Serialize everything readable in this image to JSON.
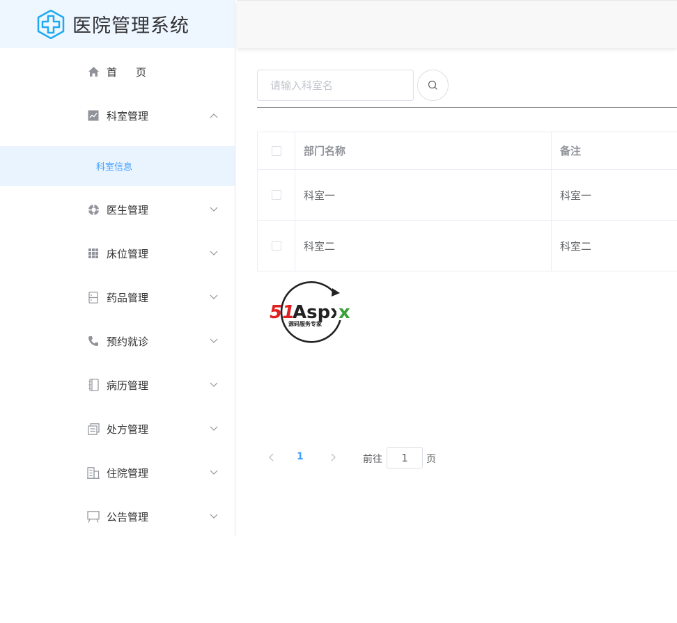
{
  "app": {
    "title": "医院管理系统"
  },
  "sidebar": {
    "items": [
      {
        "label": "首　页",
        "icon": "home-icon"
      },
      {
        "label": "科室管理",
        "icon": "chart-icon",
        "expanded": true
      },
      {
        "label": "医生管理",
        "icon": "help-circle-icon"
      },
      {
        "label": "床位管理",
        "icon": "grid-icon"
      },
      {
        "label": "药品管理",
        "icon": "cabinet-icon"
      },
      {
        "label": "预约就诊",
        "icon": "phone-icon"
      },
      {
        "label": "病历管理",
        "icon": "notebook-icon"
      },
      {
        "label": "处方管理",
        "icon": "document-icon"
      },
      {
        "label": "住院管理",
        "icon": "building-icon"
      },
      {
        "label": "公告管理",
        "icon": "board-icon"
      }
    ],
    "submenu": {
      "label": "科室信息"
    }
  },
  "search": {
    "placeholder": "请输入科室名",
    "value": ""
  },
  "table": {
    "columns": [
      "部门名称",
      "备注"
    ],
    "rows": [
      {
        "name": "科室一",
        "remark": "科室一"
      },
      {
        "name": "科室二",
        "remark": "科室二"
      }
    ]
  },
  "watermark": {
    "brand": "51Aspx",
    "slogan": "源码服务专家"
  },
  "pagination": {
    "current": "1",
    "goto_prefix": "前往",
    "goto_value": "1",
    "goto_suffix": "页"
  },
  "colors": {
    "accent": "#409eff",
    "logo": "#1eaaf1",
    "sidebar_active_bg": "#e9f4fe"
  }
}
